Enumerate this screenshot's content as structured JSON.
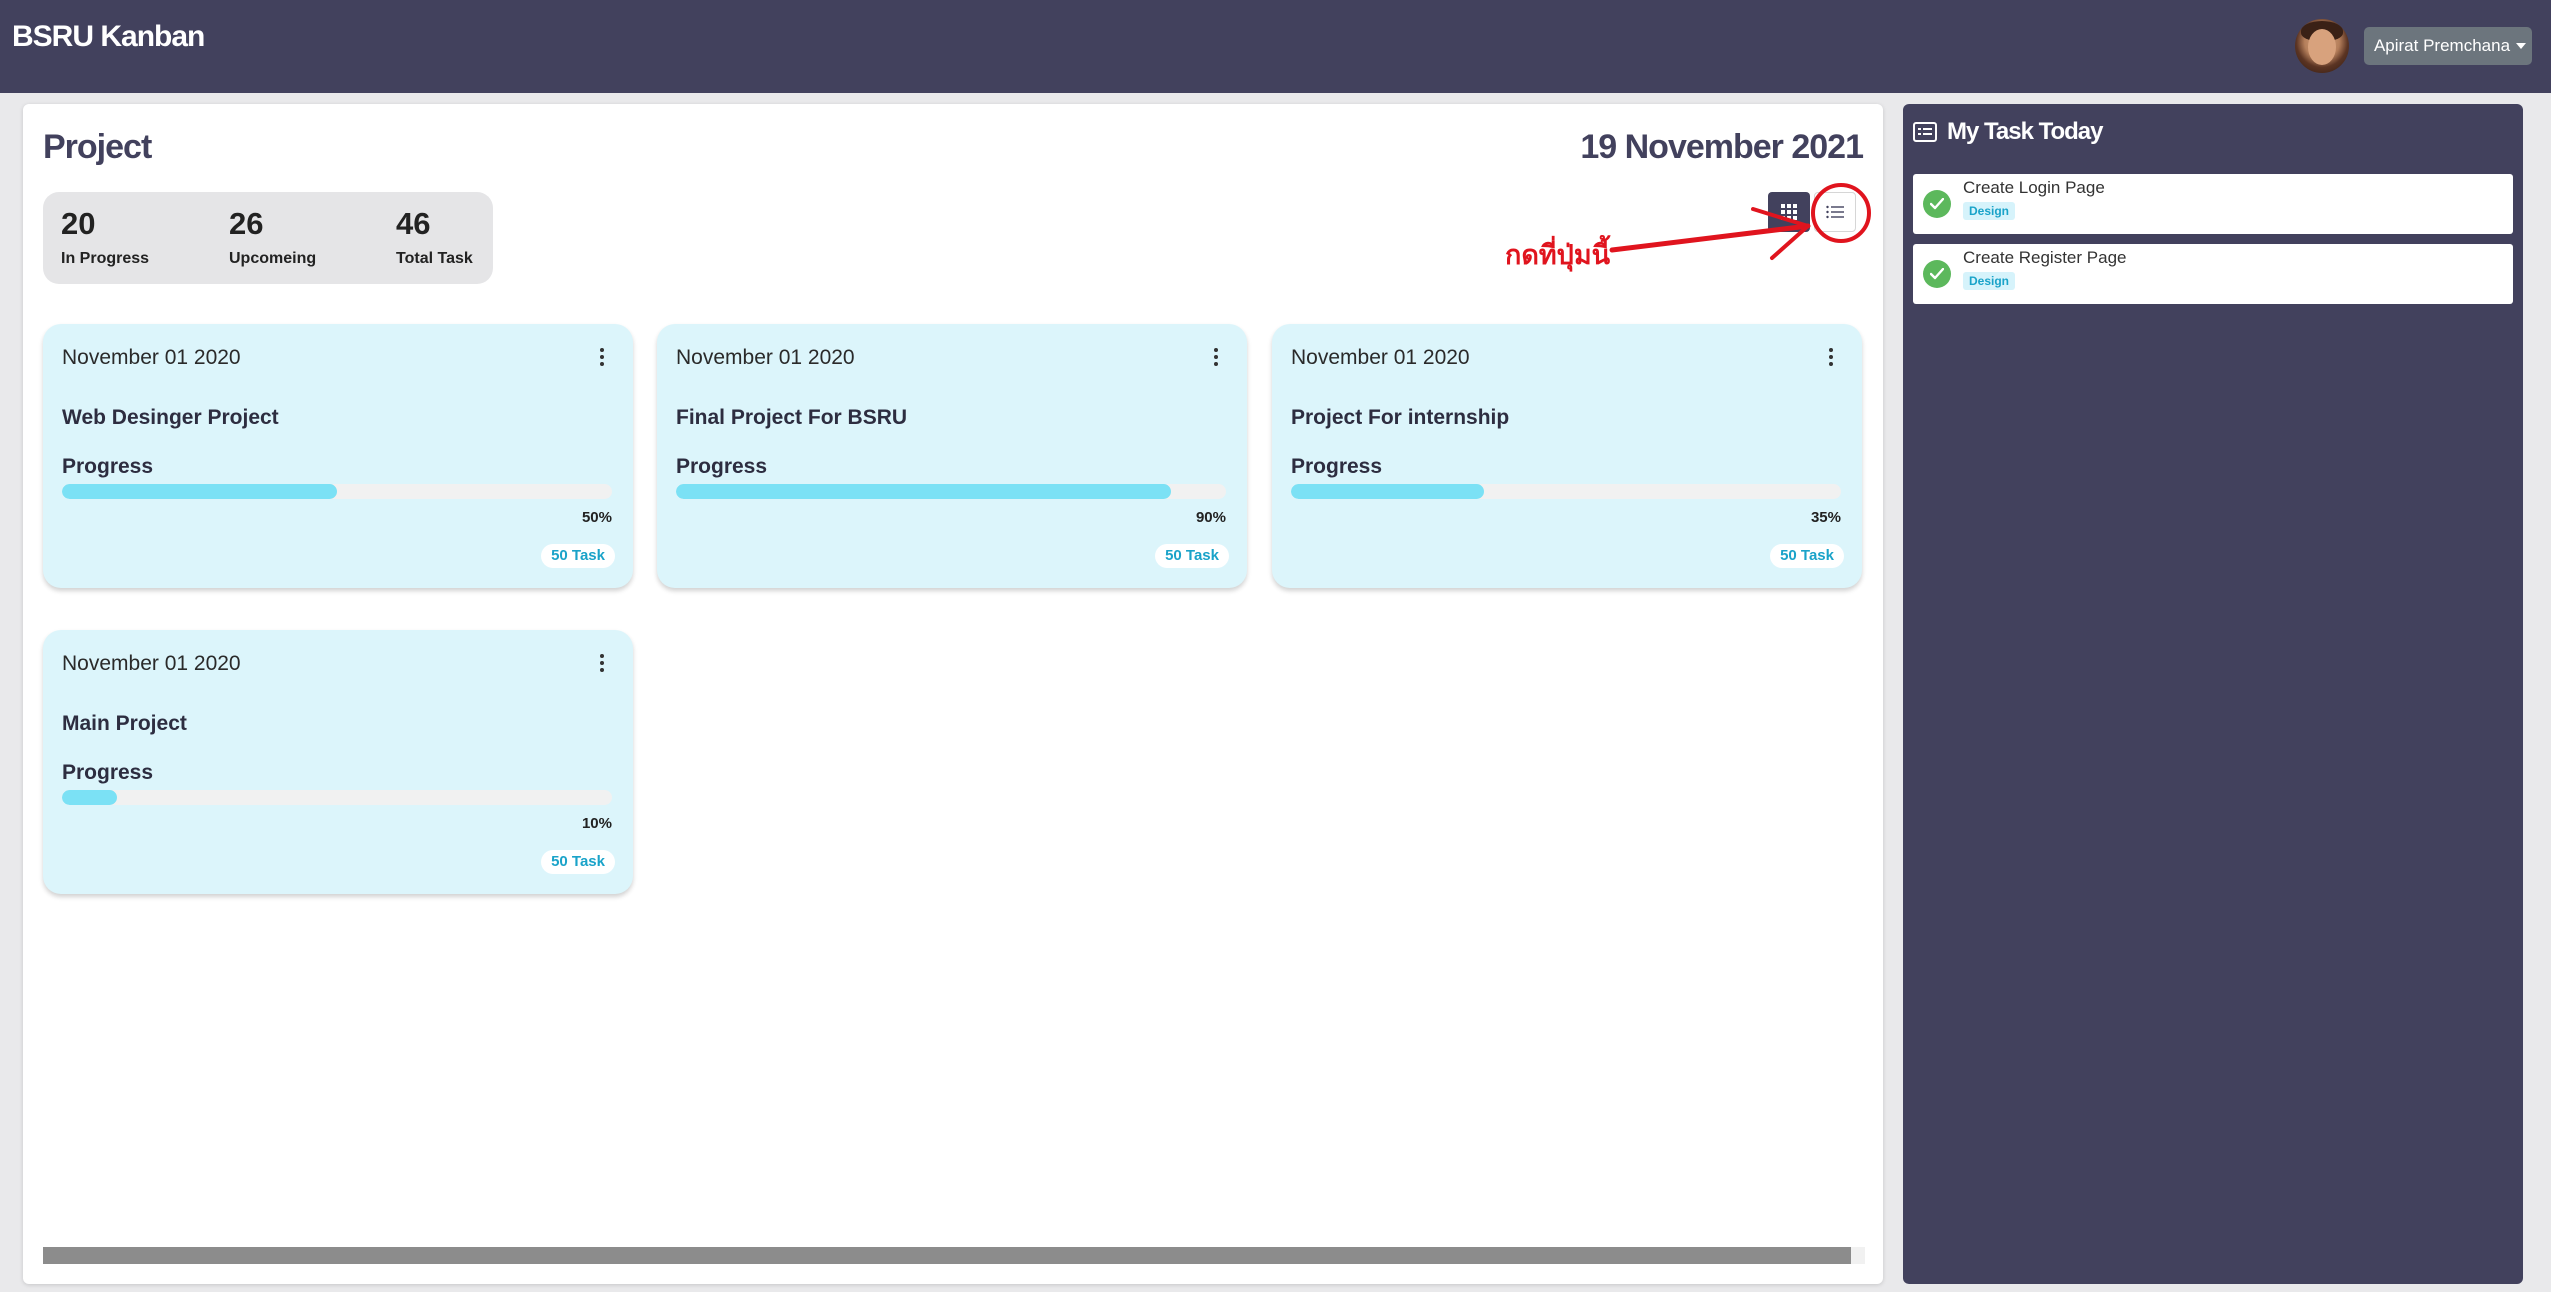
{
  "app": {
    "brand": "BSRU Kanban",
    "user_name": "Apirat Premchana"
  },
  "header": {
    "title": "Project",
    "date": "19 November 2021"
  },
  "stats": [
    {
      "value": "20",
      "label": "In Progress"
    },
    {
      "value": "26",
      "label": "Upcomeing"
    },
    {
      "value": "46",
      "label": "Total Task"
    }
  ],
  "view_toggle": {
    "grid_icon": "grid-icon",
    "list_icon": "list-icon",
    "active": "grid"
  },
  "annotation": {
    "text": "กดที่ปุ่มนี้",
    "color": "#e0141e"
  },
  "projects": [
    {
      "date": "November 01 2020",
      "name": "Web Desinger Project",
      "progress_label": "Progress",
      "progress": 50,
      "percent_text": "50%",
      "tasks": "50 Task"
    },
    {
      "date": "November 01 2020",
      "name": "Final Project For BSRU",
      "progress_label": "Progress",
      "progress": 90,
      "percent_text": "90%",
      "tasks": "50 Task"
    },
    {
      "date": "November 01 2020",
      "name": "Project For internship",
      "progress_label": "Progress",
      "progress": 35,
      "percent_text": "35%",
      "tasks": "50 Task"
    },
    {
      "date": "November 01 2020",
      "name": "Main Project",
      "progress_label": "Progress",
      "progress": 10,
      "percent_text": "10%",
      "tasks": "50 Task"
    }
  ],
  "sidebar": {
    "title": "My Task Today",
    "tasks": [
      {
        "name": "Create Login Page",
        "tag": "Design",
        "status": "done"
      },
      {
        "name": "Create Register Page",
        "tag": "Design",
        "status": "done"
      }
    ]
  },
  "colors": {
    "navbar": "#42415d",
    "card_bg": "#dcf5fb",
    "progress_fill": "#7be1f5",
    "check": "#5cb85c",
    "badge_text": "#1aa3c9"
  }
}
